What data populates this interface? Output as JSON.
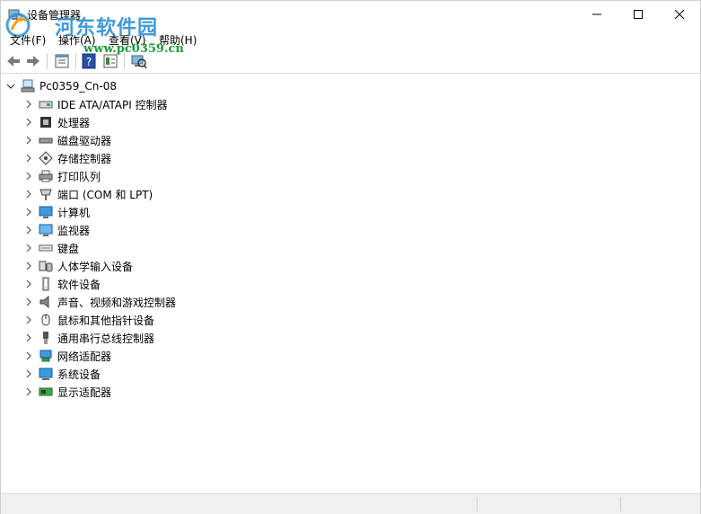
{
  "window": {
    "title": "设备管理器",
    "watermark_text": "河东软件园",
    "watermark_url": "www.pc0359.cn"
  },
  "menu": [
    "文件(F)",
    "操作(A)",
    "查看(V)",
    "帮助(H)"
  ],
  "toolbar": {
    "icons": [
      "back-arrow-icon",
      "forward-arrow-icon",
      "properties-icon",
      "help-icon",
      "view-icon",
      "scan-hardware-icon"
    ]
  },
  "tree": {
    "root": {
      "label": "Pc0359_Cn-08",
      "icon": "computer-icon",
      "expanded": true
    },
    "items": [
      {
        "label": "IDE ATA/ATAPI 控制器",
        "icon": "ide-controller-icon"
      },
      {
        "label": "处理器",
        "icon": "processor-icon"
      },
      {
        "label": "磁盘驱动器",
        "icon": "disk-drive-icon"
      },
      {
        "label": "存储控制器",
        "icon": "storage-controller-icon"
      },
      {
        "label": "打印队列",
        "icon": "printer-icon"
      },
      {
        "label": "端口 (COM 和 LPT)",
        "icon": "port-icon"
      },
      {
        "label": "计算机",
        "icon": "computer-monitor-icon"
      },
      {
        "label": "监视器",
        "icon": "monitor-icon"
      },
      {
        "label": "键盘",
        "icon": "keyboard-icon"
      },
      {
        "label": "人体学输入设备",
        "icon": "hid-icon"
      },
      {
        "label": "软件设备",
        "icon": "software-device-icon"
      },
      {
        "label": "声音、视频和游戏控制器",
        "icon": "speaker-icon"
      },
      {
        "label": "鼠标和其他指针设备",
        "icon": "mouse-icon"
      },
      {
        "label": "通用串行总线控制器",
        "icon": "usb-icon"
      },
      {
        "label": "网络适配器",
        "icon": "network-adapter-icon"
      },
      {
        "label": "系统设备",
        "icon": "system-device-icon"
      },
      {
        "label": "显示适配器",
        "icon": "display-adapter-icon"
      }
    ]
  }
}
